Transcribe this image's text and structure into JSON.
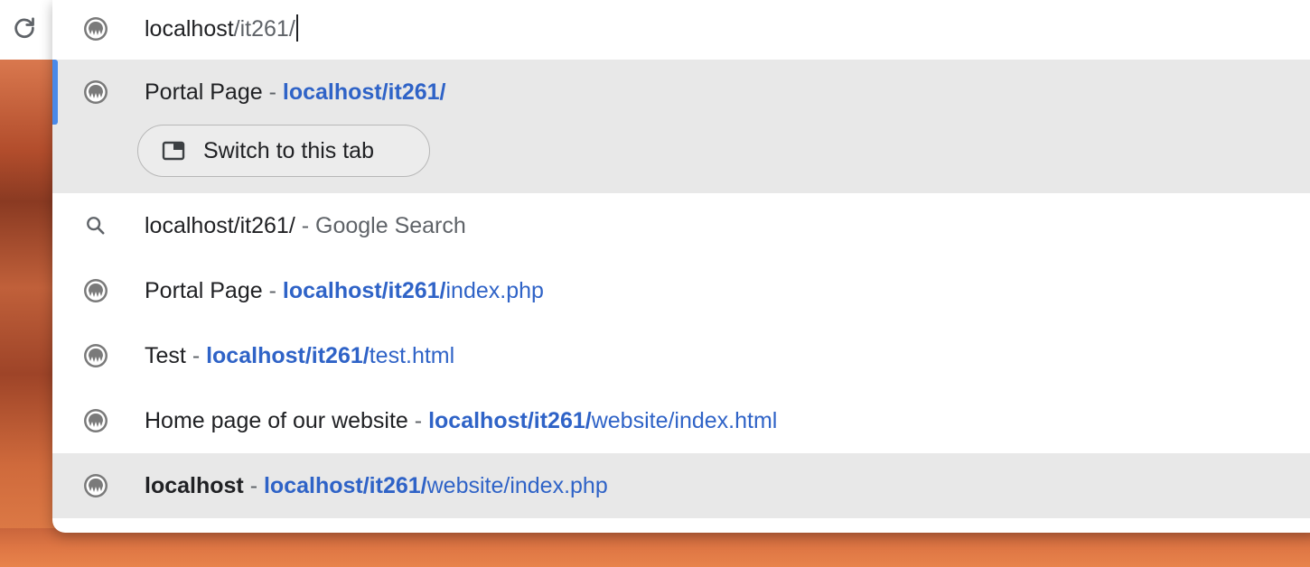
{
  "omnibox": {
    "typed_text": "localhost",
    "autocomplete_text": "/it261/",
    "icon": "site-globe-icon"
  },
  "toolbar": {
    "reload_icon": "reload-icon"
  },
  "selected_suggestion": {
    "title": "Portal Page",
    "separator": "-",
    "url_bold": "localhost/it261/",
    "url_rest": "",
    "switch_tab_label": "Switch to this tab"
  },
  "suggestions": [
    {
      "kind": "search",
      "query": "localhost/it261/",
      "separator": "-",
      "suffix": "Google Search"
    },
    {
      "kind": "history",
      "title": "Portal Page",
      "separator": "-",
      "url_bold": "localhost/it261/",
      "url_rest": "index.php"
    },
    {
      "kind": "history",
      "title": "Test",
      "separator": "-",
      "url_bold": "localhost/it261/",
      "url_rest": "test.html"
    },
    {
      "kind": "history",
      "title": "Home page of our website",
      "separator": "-",
      "url_bold": "localhost/it261/",
      "url_rest": "website/index.html"
    },
    {
      "kind": "history",
      "title": "localhost",
      "separator": "-",
      "url_bold": "localhost/it261/",
      "url_rest": "website/index.php"
    }
  ],
  "colors": {
    "url": "#2f63c7",
    "selection_bar": "#4a89e8",
    "selected_bg": "#e8e8e8"
  }
}
